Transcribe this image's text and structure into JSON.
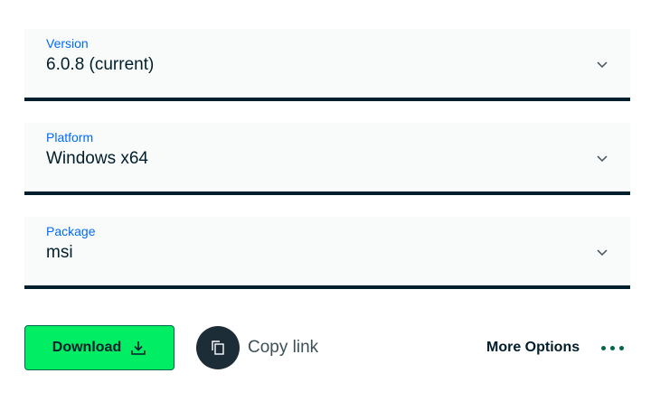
{
  "fields": [
    {
      "label": "Version",
      "value": "6.0.8 (current)",
      "icon": "chevron-down-icon"
    },
    {
      "label": "Platform",
      "value": "Windows x64",
      "icon": "chevron-down-icon"
    },
    {
      "label": "Package",
      "value": "msi",
      "icon": "chevron-down-icon"
    }
  ],
  "actions": {
    "download_label": "Download",
    "download_icon": "download-icon",
    "copy_label": "Copy link",
    "copy_icon": "copy-icon",
    "more_label": "More Options",
    "more_icon": "ellipsis-icon"
  },
  "colors": {
    "accent_green": "#00ed64",
    "label_blue": "#016bf8",
    "dark": "#001e2b",
    "dots_green": "#00684a"
  }
}
